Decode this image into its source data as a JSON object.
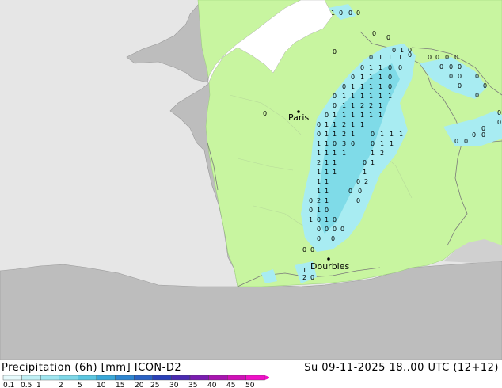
{
  "map": {
    "cities": [
      {
        "name": "Paris"
      },
      {
        "name": "Dourbies"
      }
    ],
    "colors": {
      "sea": "#e6e6e6",
      "land_outside": "#bdbdbd",
      "land_inside": "#c8f5a0",
      "precip_light": "#a8ecf2",
      "precip_mid": "#7fdbe8",
      "border": "#8a8a8a"
    }
  },
  "footer": {
    "title": "Precipitation (6h) [mm] ICON-D2",
    "datetime": "Su 09-11-2025 18..00 UTC (12+12)"
  },
  "legend": {
    "ticks": [
      "0.1",
      "0.5",
      "1",
      "2",
      "5",
      "10",
      "15",
      "20",
      "25",
      "30",
      "35",
      "40",
      "45",
      "50"
    ],
    "colors": [
      "#e6fafc",
      "#c0f0f5",
      "#a0e6f0",
      "#7fd8e8",
      "#5bc6e0",
      "#3aa8d8",
      "#2e86d0",
      "#2a62c4",
      "#2a40b8",
      "#4a2ab0",
      "#7a1cb0",
      "#a814b0",
      "#d010b8",
      "#f010c8"
    ]
  }
}
